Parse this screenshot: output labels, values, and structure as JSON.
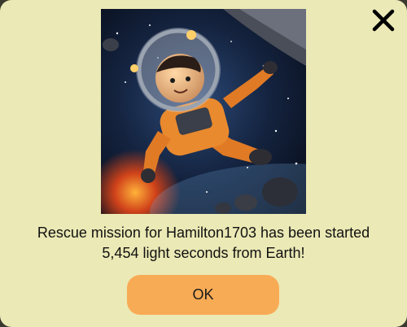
{
  "dialog": {
    "close_icon": "close-icon",
    "image_alt": "astronaut-floating-in-space",
    "message_line1": "Rescue mission for Hamilton1703 has been started",
    "message_line2": "5,454 light seconds from Earth!",
    "ok_label": "OK"
  },
  "colors": {
    "background": "#ebe9b5",
    "button": "#f8ab55",
    "text": "#111111"
  }
}
